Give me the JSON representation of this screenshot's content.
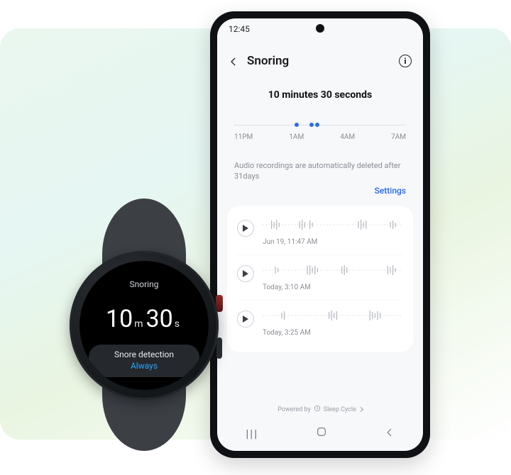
{
  "phone": {
    "status_time": "12:45",
    "header_title": "Snoring",
    "total_duration": "10 minutes 30 seconds",
    "timeline": {
      "labels": [
        "11PM",
        "1AM",
        "4AM",
        "7AM"
      ],
      "dots_pct": [
        35,
        44,
        47
      ]
    },
    "deletion_note": "Audio recordings are automatically deleted after 31days",
    "settings_label": "Settings",
    "recordings": [
      {
        "timestamp": "Jun 19,  11:47 AM"
      },
      {
        "timestamp": "Today,  3:10 AM"
      },
      {
        "timestamp": "Today,  3:25 AM"
      }
    ],
    "powered_prefix": "Powered by",
    "powered_brand": "Sleep Cycle"
  },
  "watch": {
    "title": "Snoring",
    "minutes_value": "10",
    "minutes_unit": "m",
    "seconds_value": "30",
    "seconds_unit": "s",
    "chip_line1": "Snore detection",
    "chip_line2": "Always"
  },
  "icons": {
    "back": "back-icon",
    "info": "info-icon",
    "play": "play-icon",
    "chevron": "chevron-right-icon",
    "nav_recents": "recents-icon",
    "nav_home": "home-icon",
    "nav_back": "nav-back-icon",
    "clock": "clock-icon"
  },
  "colors": {
    "accent_blue": "#1e66ff",
    "dot_blue": "#2b6fe8",
    "watch_link": "#2aa7ff"
  }
}
